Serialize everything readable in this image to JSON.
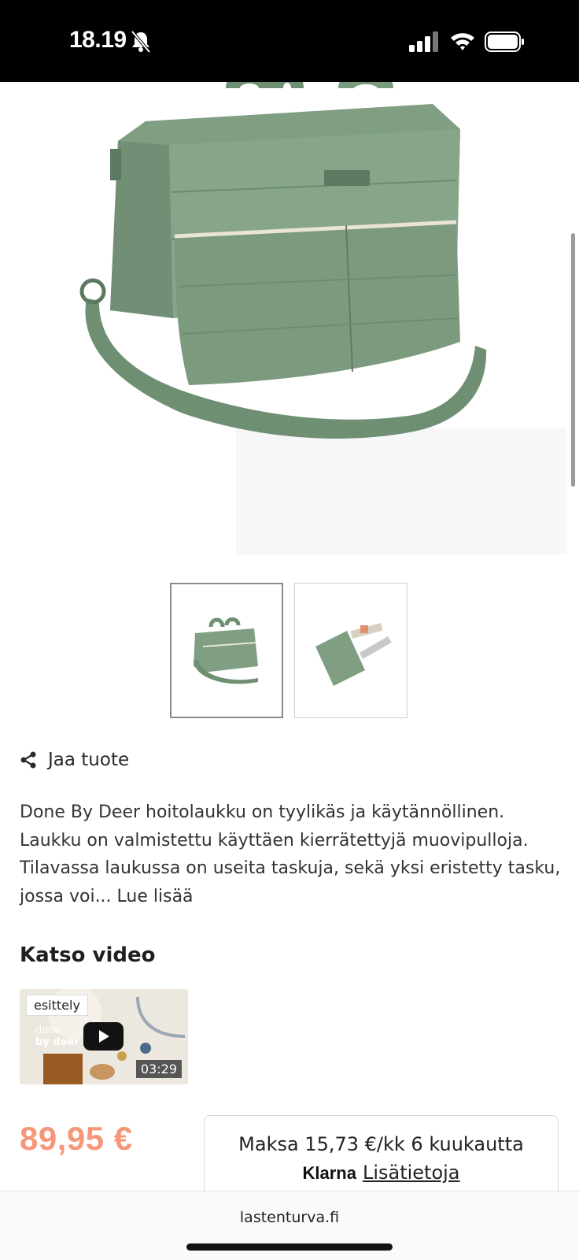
{
  "status_bar": {
    "time": "18.19",
    "icons": [
      "bell-muted-icon",
      "signal-icon",
      "wifi-icon",
      "battery-icon"
    ]
  },
  "product": {
    "image_icon": "diaper-bag-image",
    "thumbnails": [
      "diaper-bag-thumb",
      "changing-mat-thumb"
    ],
    "share_label": "Jaa tuote",
    "description": "Done By Deer hoitolaukku on tyylikäs ja käytännöllinen. Laukku on valmistettu käyttäen kierrätettyjä muovipulloja. Tilavassa laukussa on useita taskuja, sekä yksi eristetty tasku, jossa voi...",
    "read_more": "Lue lisää",
    "price": "89,95 €",
    "colors": {
      "bag_green": "#7f9e82",
      "price": "#f6977a"
    }
  },
  "video": {
    "title": "Katso video",
    "tag": "esittely",
    "duration": "03:29",
    "brand_text_1": "done",
    "brand_text_2": "by deer"
  },
  "klarna": {
    "text": "Maksa 15,73 €/kk 6 kuukautta",
    "logo": "Klarna",
    "link": "Lisätietoja"
  },
  "browser": {
    "domain": "lastenturva.fi"
  }
}
